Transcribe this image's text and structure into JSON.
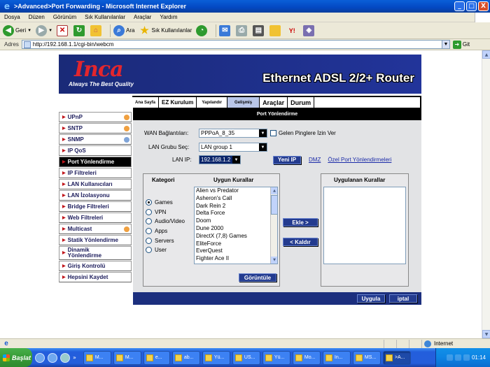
{
  "window": {
    "title": ">Advanced>Port Forwarding - Microsoft Internet Explorer",
    "buttons": {
      "minimize": "_",
      "maximize": "□",
      "close": "X"
    }
  },
  "menu": [
    "Dosya",
    "Düzen",
    "Görünüm",
    "Sık Kullanılanlar",
    "Araçlar",
    "Yardım"
  ],
  "toolbar": {
    "back": "Geri",
    "search": "Ara",
    "favorites": "Sık Kullanılanlar"
  },
  "address": {
    "label": "Adres",
    "url": "http://192.168.1.1/cgi-bin/webcm",
    "go": "Git"
  },
  "router": {
    "logo": "Inca",
    "tagline": "Always The Best Quality",
    "product": "Ethernet ADSL 2/2+ Router",
    "tabs": [
      {
        "label": "Ana Sayfa",
        "active": false
      },
      {
        "label": "EZ Kurulum",
        "active": false
      },
      {
        "label": "Yapılandır",
        "active": false
      },
      {
        "label": "Gelişmiş",
        "active": true
      },
      {
        "label": "Araçlar",
        "active": false
      },
      {
        "label": "Durum",
        "active": false
      }
    ],
    "sidebar": [
      {
        "label": "UPnP",
        "active": false,
        "gear": "orange"
      },
      {
        "label": "SNTP",
        "active": false,
        "gear": "orange"
      },
      {
        "label": "SNMP",
        "active": false,
        "gear": "blue"
      },
      {
        "label": "IP QoS",
        "active": false,
        "gear": ""
      },
      {
        "label": "Port Yönlendirme",
        "active": true,
        "gear": ""
      },
      {
        "label": "IP Filtreleri",
        "active": false,
        "gear": ""
      },
      {
        "label": "LAN Kullanıcıları",
        "active": false,
        "gear": ""
      },
      {
        "label": "LAN İzolasyonu",
        "active": false,
        "gear": ""
      },
      {
        "label": "Bridge Filtreleri",
        "active": false,
        "gear": ""
      },
      {
        "label": "Web Filtreleri",
        "active": false,
        "gear": ""
      },
      {
        "label": "Multicast",
        "active": false,
        "gear": "orange"
      },
      {
        "label": "Statik Yönlendirme",
        "active": false,
        "gear": ""
      },
      {
        "label": "Dinamik Yönlendirme",
        "active": false,
        "gear": ""
      },
      {
        "label": "Giriş Kontrolü",
        "active": false,
        "gear": ""
      },
      {
        "label": "Hepsini Kaydet",
        "active": false,
        "gear": ""
      }
    ],
    "page_title": "Port Yönlendirme",
    "wan": {
      "label": "WAN Bağlantıları:",
      "value": "PPPoA_8_35",
      "checkbox_label": "Gelen Pinglere İzin Ver"
    },
    "lan_group": {
      "label": "LAN Grubu Seç:",
      "value": "LAN group 1"
    },
    "lan_ip": {
      "label": "LAN IP:",
      "value": "192.168.1.2",
      "new_ip_button": "Yeni IP",
      "dmz_link": "DMZ",
      "custom_link": "Özel Port Yönlendirmeleri"
    },
    "category": {
      "title": "Kategori",
      "options": [
        {
          "label": "Games",
          "selected": true
        },
        {
          "label": "VPN",
          "selected": false
        },
        {
          "label": "Audio/Video",
          "selected": false
        },
        {
          "label": "Apps",
          "selected": false
        },
        {
          "label": "Servers",
          "selected": false
        },
        {
          "label": "User",
          "selected": false
        }
      ]
    },
    "available_rules": {
      "title": "Uygun Kurallar",
      "items": [
        "Alien vs Predator",
        "Asheron's Call",
        "Dark Rein 2",
        "Delta Force",
        "Doom",
        "Dune 2000",
        "DirectX (7,8) Games",
        "EliteForce",
        "EverQuest",
        "Fighter Ace II"
      ],
      "view_button": "Görüntüle"
    },
    "add_button": "Ekle >",
    "remove_button": "< Kaldır",
    "applied_rules": {
      "title": "Uygulanan Kurallar",
      "items": []
    },
    "apply_button": "Uygula",
    "cancel_button": "iptal"
  },
  "status": {
    "zone": "Internet"
  },
  "taskbar": {
    "start": "Başlat",
    "tasks": [
      {
        "label": "M...",
        "active": false
      },
      {
        "label": "M...",
        "active": false
      },
      {
        "label": "e...",
        "active": false
      },
      {
        "label": "ab...",
        "active": false
      },
      {
        "label": "Yü...",
        "active": false
      },
      {
        "label": "US...",
        "active": false
      },
      {
        "label": "Yü...",
        "active": false
      },
      {
        "label": "Mo...",
        "active": false
      },
      {
        "label": "In...",
        "active": false
      },
      {
        "label": "MS...",
        "active": false
      },
      {
        "label": ">A...",
        "active": true
      }
    ],
    "clock": "01:14"
  }
}
